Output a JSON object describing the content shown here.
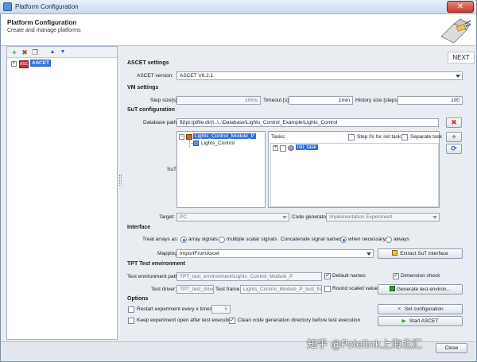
{
  "window": {
    "title": "Platform Configuration",
    "close_glyph": "✕"
  },
  "header": {
    "title": "Platform Configuration",
    "subtitle": "Create and manage platforms"
  },
  "left_toolbar": {
    "add": "+",
    "remove": "✖",
    "copy": "❐",
    "up": "▲",
    "down": "▼"
  },
  "tree": {
    "expander": "+",
    "icon_text": "ASC",
    "root_label": "ASCET"
  },
  "next_label": "NEXT",
  "ascet_settings": {
    "section": "ASCET settings",
    "version_label": "ASCET version:",
    "version_value": "ASCET V6.2.1"
  },
  "vm_settings": {
    "section": "VM settings",
    "step_size_label": "Step size[s]:",
    "step_size_value": "10ms",
    "timeout_label": "Timeout [s]:",
    "timeout_value": "1min",
    "history_label": "History size [steps]:",
    "history_value": "100"
  },
  "sut_config": {
    "section": "SuT configuration",
    "db_path_label": "Database path:",
    "db_path_value": "${tpt.tptfile.dir}\\..\\..\\Database\\Lights_Control_Example\\Lights_Control",
    "sut_label": "SuT:",
    "sut_tree": {
      "root": "Lights_Control_Module_P",
      "child": "Lights_Control",
      "expander": "−"
    },
    "tasks_label": "Tasks:",
    "step0_label": "Step 0s for init task",
    "separate_label": "Separate task",
    "task_item": "init_task",
    "task_expander": "+",
    "target_label": "Target:",
    "target_value": "PC",
    "codegen_label": "Code generator:",
    "codegen_value": "Implementation Experiment"
  },
  "interface": {
    "section": "Interface",
    "treat_label": "Treat arrays as:",
    "array_signals": "array signals",
    "multiple_scalar": "multiple scalar signals",
    "concat_label": "Concatenate signal names:",
    "when_necessary": "when necessary",
    "always": "always",
    "mapping_label": "Mapping:",
    "mapping_value": "ImportFromAscet",
    "extract_button": "Extract SuT interface"
  },
  "tpt_env": {
    "section": "TPT Test environment",
    "env_path_label": "Test environment path:",
    "env_path_value": "TPT_test_environment\\Lights_Control_Module_P",
    "default_names_label": "Default names",
    "dimension_label": "Dimension check",
    "driver_label": "Test driver:",
    "driver_value": "TPT_test_driver",
    "frame_label": "Test frame:",
    "frame_value": "Lights_Control_Module_P_test_frame",
    "round_label": "Round scaled values",
    "generate_button": "Generate test environ..."
  },
  "options": {
    "section": "Options",
    "restart_label": "Restart experiment every x times:",
    "restart_value": "5",
    "keep_open_label": "Keep experiment open after test execution",
    "clean_label": "Clean code generation directory before test execution",
    "set_config_button": "Set configuration",
    "start_button": "Start ASCET"
  },
  "footer": {
    "close_button": "Close"
  },
  "watermark": "知乎 @Polelink上海北汇",
  "icons": {
    "add_color": "#2e9b2e",
    "remove_color": "#d43a2a",
    "arrow_color": "#2d5fbf",
    "accent_color": "#2f6ed6"
  },
  "check_mark": "✓"
}
